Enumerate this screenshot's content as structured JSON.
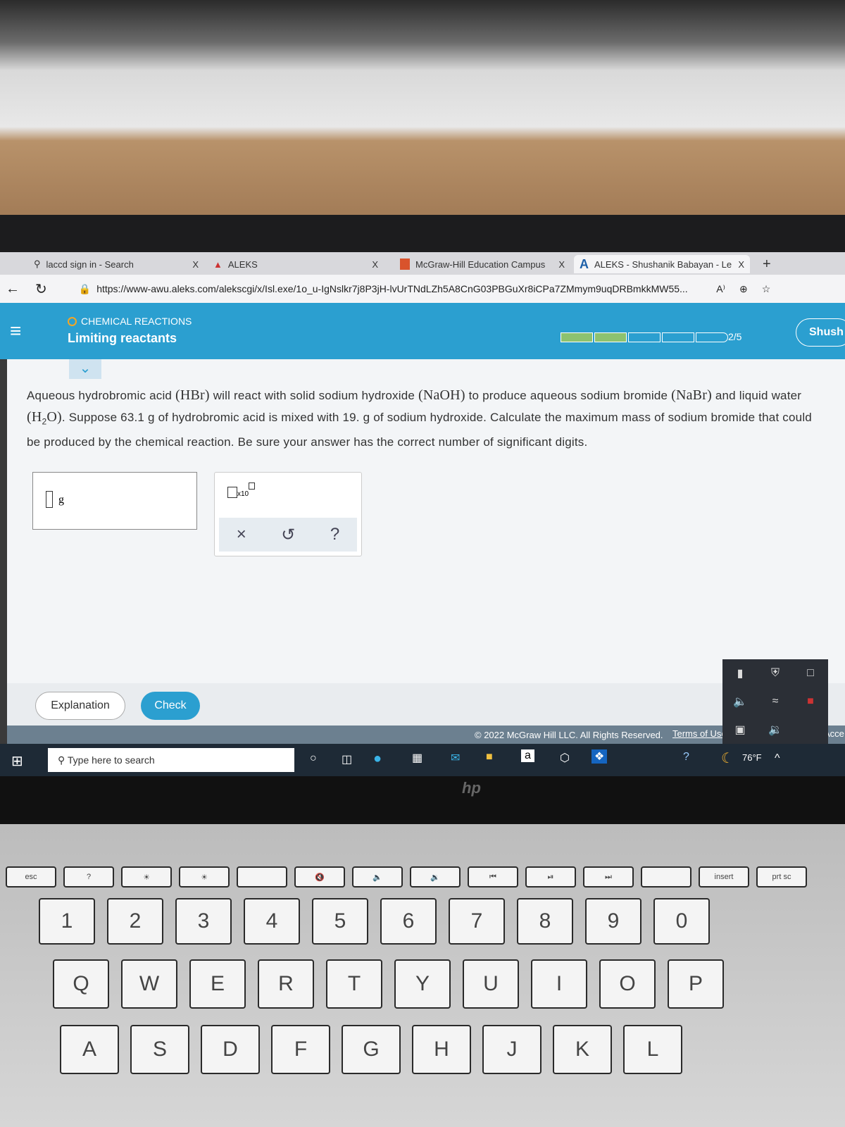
{
  "browser": {
    "tabs": [
      {
        "label": "laccd sign in - Search",
        "close": "X"
      },
      {
        "label": "ALEKS",
        "close": "X"
      },
      {
        "label": "McGraw-Hill Education Campus",
        "close": "X"
      },
      {
        "label": "ALEKS - Shushanik Babayan - Le",
        "close": "X",
        "active": true
      }
    ],
    "new_tab": "+",
    "url": "https://www-awu.aleks.com/alekscgi/x/Isl.exe/1o_u-IgNslkr7j8P3jH-lvUrTNdLZh5A8CnG03PBGuXr8iCPa7ZMmym9uqDRBmkkMW55...",
    "read_aloud": "A⁾"
  },
  "aleks": {
    "topic": "CHEMICAL REACTIONS",
    "title": "Limiting reactants",
    "progress": {
      "label": "2/5",
      "filled": 2,
      "total": 5,
      "accent": "#8dc26f"
    },
    "user": "Shush",
    "question": {
      "p1": "Aqueous hydrobromic acid ",
      "hbr": "(HBr)",
      "p2": " will react with solid sodium hydroxide ",
      "naoh": "(NaOH)",
      "p3": " to produce aqueous sodium bromide ",
      "nabr": "(NaBr)",
      "p4": " and liquid water ",
      "h2o_a": "(H",
      "h2o_sub": "2",
      "h2o_b": "O)",
      "p5": ". Suppose 63.1 g of hydrobromic acid is mixed with 19. g of sodium hydroxide. Calculate the maximum mass of sodium bromide that could be produced by the chemical reaction. Be sure your answer has the correct number of significant digits."
    },
    "answer": {
      "value": "",
      "unit": "g"
    },
    "tools": {
      "x10": "x10",
      "clear": "×",
      "undo": "↺",
      "help": "?"
    },
    "explanation_label": "Explanation",
    "check_label": "Check",
    "footer": {
      "copyright": "© 2022 McGraw Hill LLC. All Rights Reserved.",
      "terms": "Terms of Use",
      "sep": "|",
      "access": "Acce"
    }
  },
  "taskbar": {
    "search_placeholder": "Type here to search",
    "weather": "76°F"
  },
  "keyboard": {
    "fn": [
      "esc",
      "?",
      "☀",
      "☀",
      "",
      "🔇",
      "🔈",
      "🔉",
      "⏮",
      "⏯",
      "⏭",
      "",
      "insert",
      "prt sc"
    ],
    "num": [
      "1",
      "2",
      "3",
      "4",
      "5",
      "6",
      "7",
      "8",
      "9",
      "0"
    ],
    "qrow": [
      "Q",
      "W",
      "E",
      "R",
      "T",
      "Y",
      "U",
      "I",
      "O",
      "P"
    ],
    "arow": [
      "A",
      "S",
      "D",
      "F",
      "G",
      "H",
      "J",
      "K",
      "L"
    ],
    "brand": "hp"
  }
}
